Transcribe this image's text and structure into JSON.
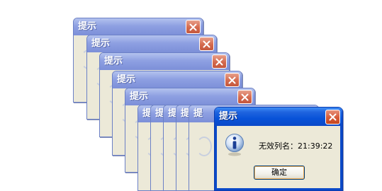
{
  "dialog": {
    "title": "提示",
    "message": "无效列名：21:39:22",
    "ok_label": "确定",
    "icon": "info-icon",
    "close_icon": "close-icon"
  },
  "stack": {
    "background_dialog_count": 10,
    "background_titles": [
      "提示",
      "提示",
      "提示",
      "提示",
      "提示",
      "提",
      "提",
      "提",
      "提",
      "提"
    ]
  },
  "colors": {
    "active_title": "#0a49c8",
    "inactive_title": "#8ea0e2",
    "close_button": "#d65a38",
    "dialog_face": "#ece9d8"
  }
}
